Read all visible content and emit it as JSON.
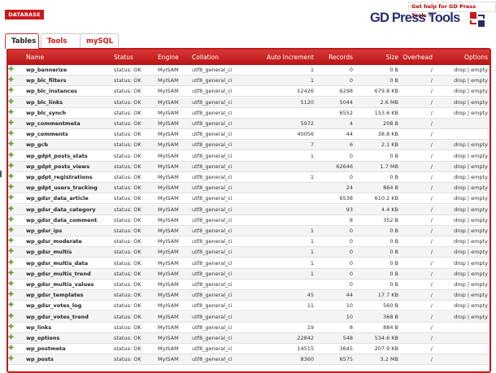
{
  "header": {
    "badge": "DATABASE",
    "help_link": "Get help for GD Press Tools",
    "help_arrow": "▼",
    "logo": "GD Press Tools"
  },
  "tabs": [
    {
      "label": "Tables",
      "active": true
    },
    {
      "label": "Tools",
      "active": false
    },
    {
      "label": "mySQL",
      "active": false
    }
  ],
  "table": {
    "columns": {
      "name": "Name",
      "status": "Status",
      "engine": "Engine",
      "collation": "Collation",
      "auto_increment": "Auto Increment",
      "records": "Records",
      "size": "Size",
      "overhead": "Overhead",
      "options": "Options"
    },
    "rows": [
      {
        "name": "wp_bannerize",
        "status": "status: OK",
        "engine": "MyISAM",
        "collation": "utf8_general_ci",
        "ai": "1",
        "records": "0",
        "size": "0 B",
        "overhead": "/",
        "options": "drop | empty"
      },
      {
        "name": "wp_blc_filters",
        "status": "status: OK",
        "engine": "MyISAM",
        "collation": "utf8_general_ci",
        "ai": "1",
        "records": "0",
        "size": "0 B",
        "overhead": "/",
        "options": "drop | empty"
      },
      {
        "name": "wp_blc_instances",
        "status": "status: OK",
        "engine": "MyISAM",
        "collation": "utf8_general_ci",
        "ai": "12426",
        "records": "6298",
        "size": "679.8 KB",
        "overhead": "/",
        "options": "drop | empty"
      },
      {
        "name": "wp_blc_links",
        "status": "status: OK",
        "engine": "MyISAM",
        "collation": "utf8_general_ci",
        "ai": "5120",
        "records": "5044",
        "size": "2.6 MB",
        "overhead": "/",
        "options": "drop | empty"
      },
      {
        "name": "wp_blc_synch",
        "status": "status: OK",
        "engine": "MyISAM",
        "collation": "utf8_general_ci",
        "ai": "",
        "records": "6552",
        "size": "153.6 KB",
        "overhead": "/",
        "options": "drop | empty"
      },
      {
        "name": "wp_commentmeta",
        "status": "status: OK",
        "engine": "MyISAM",
        "collation": "utf8_general_ci",
        "ai": "5972",
        "records": "4",
        "size": "208 B",
        "overhead": "/",
        "options": ""
      },
      {
        "name": "wp_comments",
        "status": "status: OK",
        "engine": "MyISAM",
        "collation": "utf8_general_ci",
        "ai": "40056",
        "records": "44",
        "size": "38.8 KB",
        "overhead": "/",
        "options": ""
      },
      {
        "name": "wp_gcb",
        "status": "status: OK",
        "engine": "MyISAM",
        "collation": "utf8_general_ci",
        "ai": "7",
        "records": "6",
        "size": "2.1 KB",
        "overhead": "/",
        "options": "drop | empty"
      },
      {
        "name": "wp_gdpt_posts_stats",
        "status": "status: OK",
        "engine": "MyISAM",
        "collation": "utf8_general_ci",
        "ai": "1",
        "records": "0",
        "size": "0 B",
        "overhead": "/",
        "options": "drop | empty"
      },
      {
        "name": "wp_gdpt_posts_views",
        "status": "status: OK",
        "engine": "MyISAM",
        "collation": "utf8_general_ci",
        "ai": "",
        "records": "62646",
        "size": "1.7 MB",
        "overhead": "/",
        "options": "drop | empty"
      },
      {
        "name": "wp_gdpt_registrations",
        "status": "status: OK",
        "engine": "MyISAM",
        "collation": "utf8_general_ci",
        "ai": "1",
        "records": "0",
        "size": "0 B",
        "overhead": "/",
        "options": "drop | empty"
      },
      {
        "name": "wp_gdpt_users_tracking",
        "status": "status: OK",
        "engine": "MyISAM",
        "collation": "utf8_general_ci",
        "ai": "",
        "records": "24",
        "size": "864 B",
        "overhead": "/",
        "options": "drop | empty"
      },
      {
        "name": "wp_gdsr_data_article",
        "status": "status: OK",
        "engine": "MyISAM",
        "collation": "utf8_general_ci",
        "ai": "",
        "records": "6538",
        "size": "610.2 KB",
        "overhead": "/",
        "options": "drop | empty"
      },
      {
        "name": "wp_gdsr_data_category",
        "status": "status: OK",
        "engine": "MyISAM",
        "collation": "utf8_general_ci",
        "ai": "",
        "records": "93",
        "size": "4.4 KB",
        "overhead": "/",
        "options": "drop | empty"
      },
      {
        "name": "wp_gdsr_data_comment",
        "status": "status: OK",
        "engine": "MyISAM",
        "collation": "utf8_general_ci",
        "ai": "",
        "records": "8",
        "size": "352 B",
        "overhead": "/",
        "options": "drop | empty"
      },
      {
        "name": "wp_gdsr_ips",
        "status": "status: OK",
        "engine": "MyISAM",
        "collation": "utf8_general_ci",
        "ai": "1",
        "records": "0",
        "size": "0 B",
        "overhead": "/",
        "options": "drop | empty"
      },
      {
        "name": "wp_gdsr_moderate",
        "status": "status: OK",
        "engine": "MyISAM",
        "collation": "utf8_general_ci",
        "ai": "1",
        "records": "0",
        "size": "0 B",
        "overhead": "/",
        "options": "drop | empty"
      },
      {
        "name": "wp_gdsr_multis",
        "status": "status: OK",
        "engine": "MyISAM",
        "collation": "utf8_general_ci",
        "ai": "1",
        "records": "0",
        "size": "0 B",
        "overhead": "/",
        "options": "drop | empty"
      },
      {
        "name": "wp_gdsr_multis_data",
        "status": "status: OK",
        "engine": "MyISAM",
        "collation": "utf8_general_ci",
        "ai": "1",
        "records": "0",
        "size": "0 B",
        "overhead": "/",
        "options": "drop | empty"
      },
      {
        "name": "wp_gdsr_multis_trend",
        "status": "status: OK",
        "engine": "MyISAM",
        "collation": "utf8_general_ci",
        "ai": "1",
        "records": "0",
        "size": "0 B",
        "overhead": "/",
        "options": "drop | empty"
      },
      {
        "name": "wp_gdsr_multis_values",
        "status": "status: OK",
        "engine": "MyISAM",
        "collation": "utf8_general_ci",
        "ai": "",
        "records": "0",
        "size": "0 B",
        "overhead": "/",
        "options": "drop | empty"
      },
      {
        "name": "wp_gdsr_templates",
        "status": "status: OK",
        "engine": "MyISAM",
        "collation": "utf8_general_ci",
        "ai": "45",
        "records": "44",
        "size": "17.7 KB",
        "overhead": "/",
        "options": "drop | empty"
      },
      {
        "name": "wp_gdsr_votes_log",
        "status": "status: OK",
        "engine": "MyISAM",
        "collation": "utf8_general_ci",
        "ai": "11",
        "records": "10",
        "size": "560 B",
        "overhead": "/",
        "options": "drop | empty"
      },
      {
        "name": "wp_gdsr_votes_trend",
        "status": "status: OK",
        "engine": "MyISAM",
        "collation": "utf8_general_ci",
        "ai": "",
        "records": "10",
        "size": "368 B",
        "overhead": "/",
        "options": "drop | empty"
      },
      {
        "name": "wp_links",
        "status": "status: OK",
        "engine": "MyISAM",
        "collation": "utf8_general_ci",
        "ai": "19",
        "records": "8",
        "size": "884 B",
        "overhead": "/",
        "options": ""
      },
      {
        "name": "wp_options",
        "status": "status: OK",
        "engine": "MyISAM",
        "collation": "utf8_general_ci",
        "ai": "22842",
        "records": "548",
        "size": "534.6 KB",
        "overhead": "/",
        "options": ""
      },
      {
        "name": "wp_postmeta",
        "status": "status: OK",
        "engine": "MyISAM",
        "collation": "utf8_general_ci",
        "ai": "14515",
        "records": "3645",
        "size": "207.9 KB",
        "overhead": "/",
        "options": ""
      },
      {
        "name": "wp_posts",
        "status": "status: OK",
        "engine": "MyISAM",
        "collation": "utf8_general_ci",
        "ai": "8360",
        "records": "6575",
        "size": "3.2 MB",
        "overhead": "/",
        "options": ""
      }
    ]
  },
  "colors": {
    "accent": "#cc1717",
    "logo": "#2a2a72",
    "expand_icon": "#5a9e2f"
  }
}
